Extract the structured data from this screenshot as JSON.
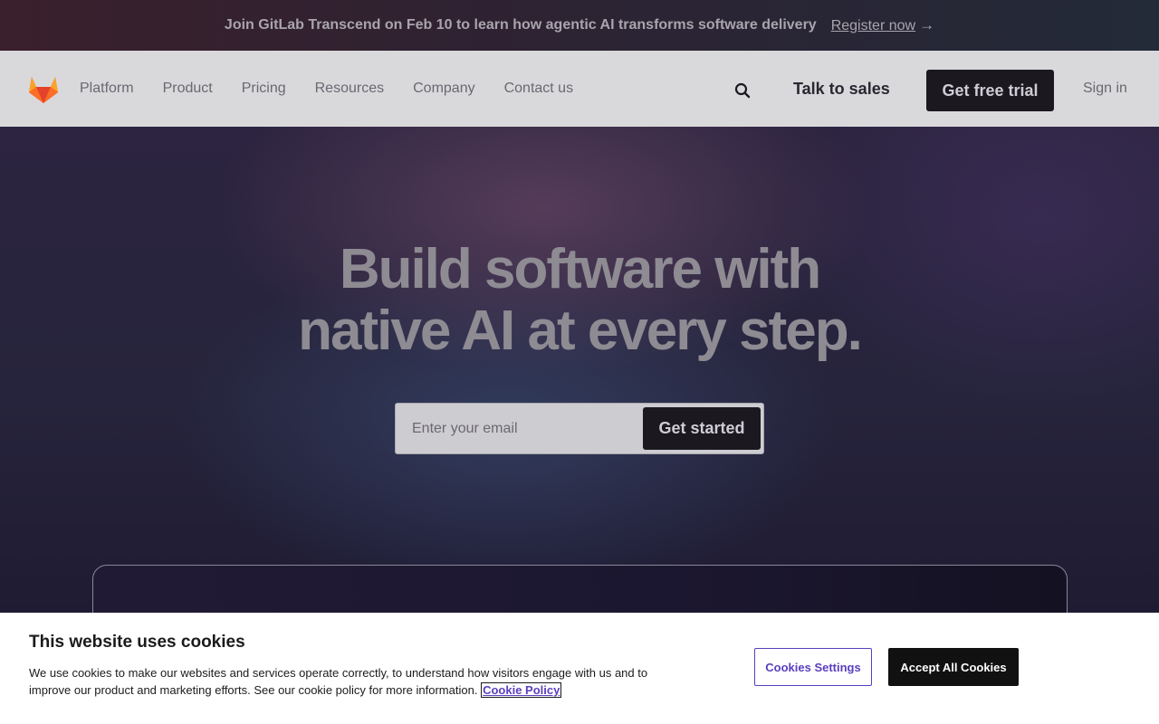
{
  "banner": {
    "text": "Join GitLab Transcend on Feb 10 to learn how agentic AI transforms software delivery",
    "link_label": "Register now",
    "arrow": "→"
  },
  "nav": {
    "logo_icon": "gitlab-tanuki-icon",
    "links": [
      "Platform",
      "Product",
      "Pricing",
      "Resources",
      "Company",
      "Contact us"
    ],
    "search_icon": "search-icon",
    "talk_to_sales": "Talk to sales",
    "free_trial": "Get free trial",
    "sign_in": "Sign in"
  },
  "hero": {
    "title_line1": "Build software with",
    "title_line2": "native AI at every step.",
    "email_placeholder": "Enter your email",
    "cta": "Get started"
  },
  "cookie": {
    "title": "This website uses cookies",
    "text": "We use cookies to make our websites and services operate correctly, to understand how visitors engage with us and to improve our product and marketing efforts. See our cookie policy for more information.",
    "policy_link": "Cookie Policy",
    "settings_label": "Cookies Settings",
    "accept_label": "Accept All Cookies"
  },
  "colors": {
    "logo_orange": "#e24329",
    "logo_light": "#fca326",
    "cookie_accent": "#5a3fbf"
  }
}
